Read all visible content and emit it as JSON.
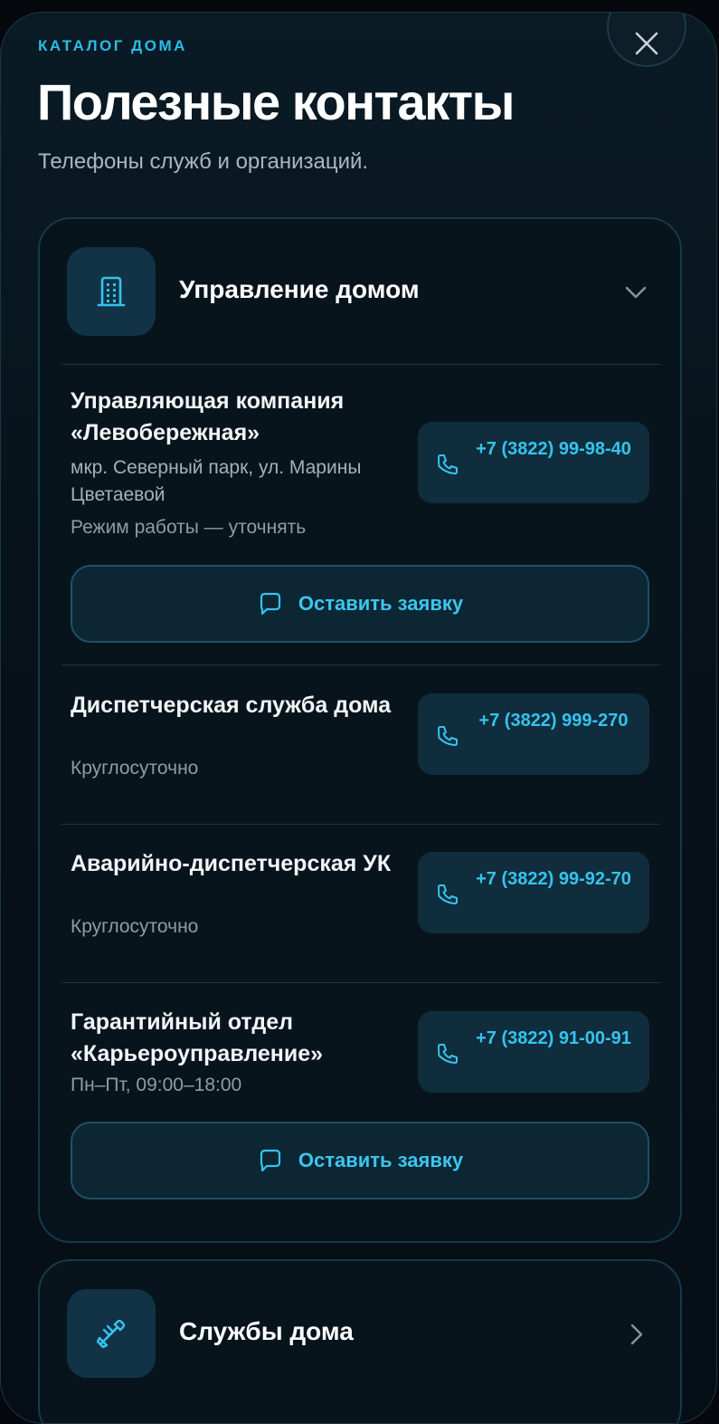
{
  "header": {
    "eyebrow": "КАТАЛОГ ДОМА",
    "title": "Полезные контакты",
    "subtitle": "Телефоны служб и организаций."
  },
  "close_icon": "close-icon",
  "sections": {
    "management": {
      "title": "Управление домом",
      "icon": "building-icon",
      "expanded": true,
      "contacts": [
        {
          "name": "Управляющая компания «Левобережная»",
          "address": "мкр. Северный парк, ул. Марины Цветаевой",
          "hours": "Режим работы — уточнять",
          "phone": "+7 (3822) 99-98-40",
          "request_label": "Оставить заявку"
        },
        {
          "name": "Диспетчерская служба дома",
          "hours": "Круглосуточно",
          "phone": "+7 (3822) 999-270"
        },
        {
          "name": "Аварийно-диспетчерская УК",
          "hours": "Круглосуточно",
          "phone": "+7 (3822) 99-92-70"
        },
        {
          "name": "Гарантийный отдел «Карьероуправление»",
          "hours": "Пн–Пт, 09:00–18:00",
          "phone": "+7 (3822) 91-00-91",
          "request_label": "Оставить заявку"
        }
      ]
    },
    "services": {
      "title": "Службы дома",
      "icon": "tools-icon",
      "expanded": false
    }
  },
  "colors": {
    "accent": "#36c3ee",
    "background": "#071219",
    "card": "#08141c",
    "button": "#0f2d3c"
  }
}
